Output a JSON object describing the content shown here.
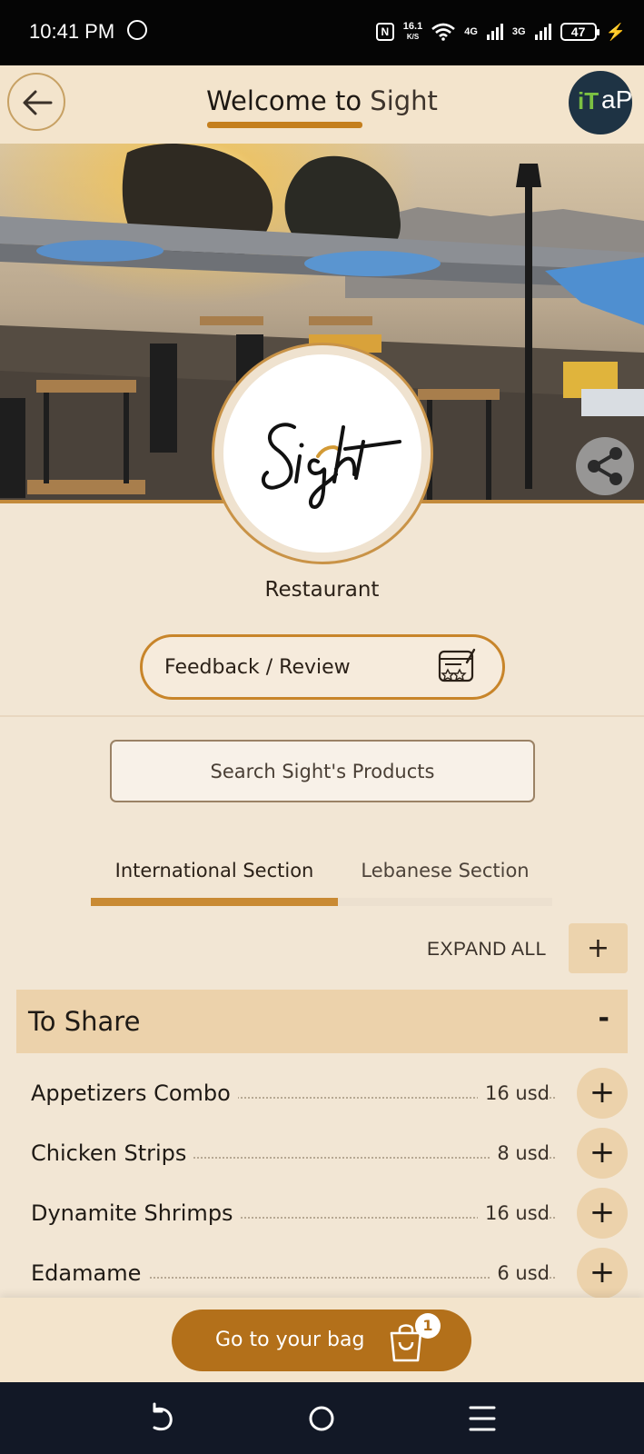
{
  "status_bar": {
    "time": "10:41 PM",
    "net_speed_value": "16.1",
    "net_speed_unit": "K/S",
    "signal1_label": "4G",
    "signal2_label": "3G",
    "battery": "47",
    "nfc_label": "N"
  },
  "header": {
    "title_part1": "Welcome to",
    "title_part2": "Sight",
    "brand_logo_text1": "iT",
    "brand_logo_text2": "aP"
  },
  "profile": {
    "logo_text": "Sight",
    "type": "Restaurant"
  },
  "feedback": {
    "label": "Feedback / Review"
  },
  "search": {
    "placeholder": "Search Sight's Products"
  },
  "tabs": [
    {
      "label": "International Section",
      "active": true
    },
    {
      "label": "Lebanese Section",
      "active": false
    }
  ],
  "expand_all": {
    "label": "EXPAND ALL",
    "icon": "+"
  },
  "section": {
    "title": "To Share",
    "toggle": "-",
    "items": [
      {
        "name": "Appetizers Combo",
        "price": "16 usd"
      },
      {
        "name": "Chicken Strips",
        "price": "8 usd"
      },
      {
        "name": "Dynamite Shrimps",
        "price": "16 usd"
      },
      {
        "name": "Edamame",
        "price": "6 usd"
      }
    ]
  },
  "bag": {
    "label": "Go to your bag",
    "count": "1"
  },
  "colors": {
    "accent": "#c47f1e",
    "bag_button": "#b3701a",
    "background": "#f2e6d4",
    "section_header": "#ecd2ab"
  }
}
